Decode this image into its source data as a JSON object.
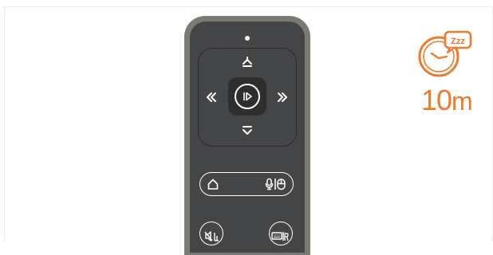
{
  "remote": {
    "colors": {
      "outer": "#7d7a76",
      "inner": "#444547",
      "icon": "#ffffff"
    },
    "icons": {
      "up": "channel-up-icon",
      "down": "channel-down-icon",
      "left": "rewind-icon",
      "right": "fast-forward-icon",
      "center": "play-pause-icon",
      "home": "home-icon",
      "voice": "microphone-mouse-icon",
      "mute": "mute-icon",
      "keyboard": "keyboard-icon"
    }
  },
  "sleep_timer": {
    "icon": "sleep-timer-icon",
    "icon_badge": "Zzz",
    "value": "10",
    "unit": "m",
    "color": "#ee7a2c"
  }
}
